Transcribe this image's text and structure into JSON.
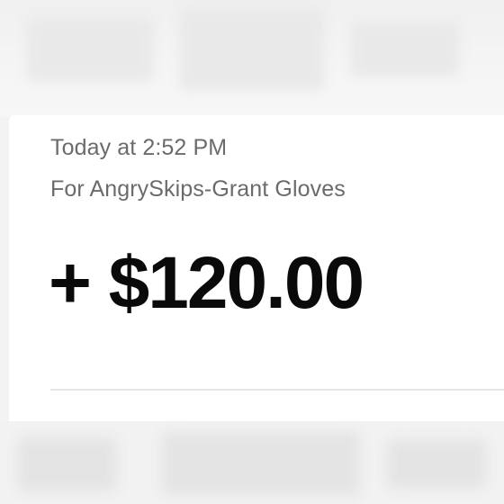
{
  "transaction": {
    "timestamp": "Today at 2:52 PM",
    "memo": "For AngrySkips-Grant Gloves",
    "amount": "+ $120.00"
  },
  "colors": {
    "text_primary": "#0a0a0a",
    "text_secondary": "#6b6b6b",
    "divider": "#e6e6e6",
    "background": "#f3f3f3",
    "card": "#ffffff"
  }
}
